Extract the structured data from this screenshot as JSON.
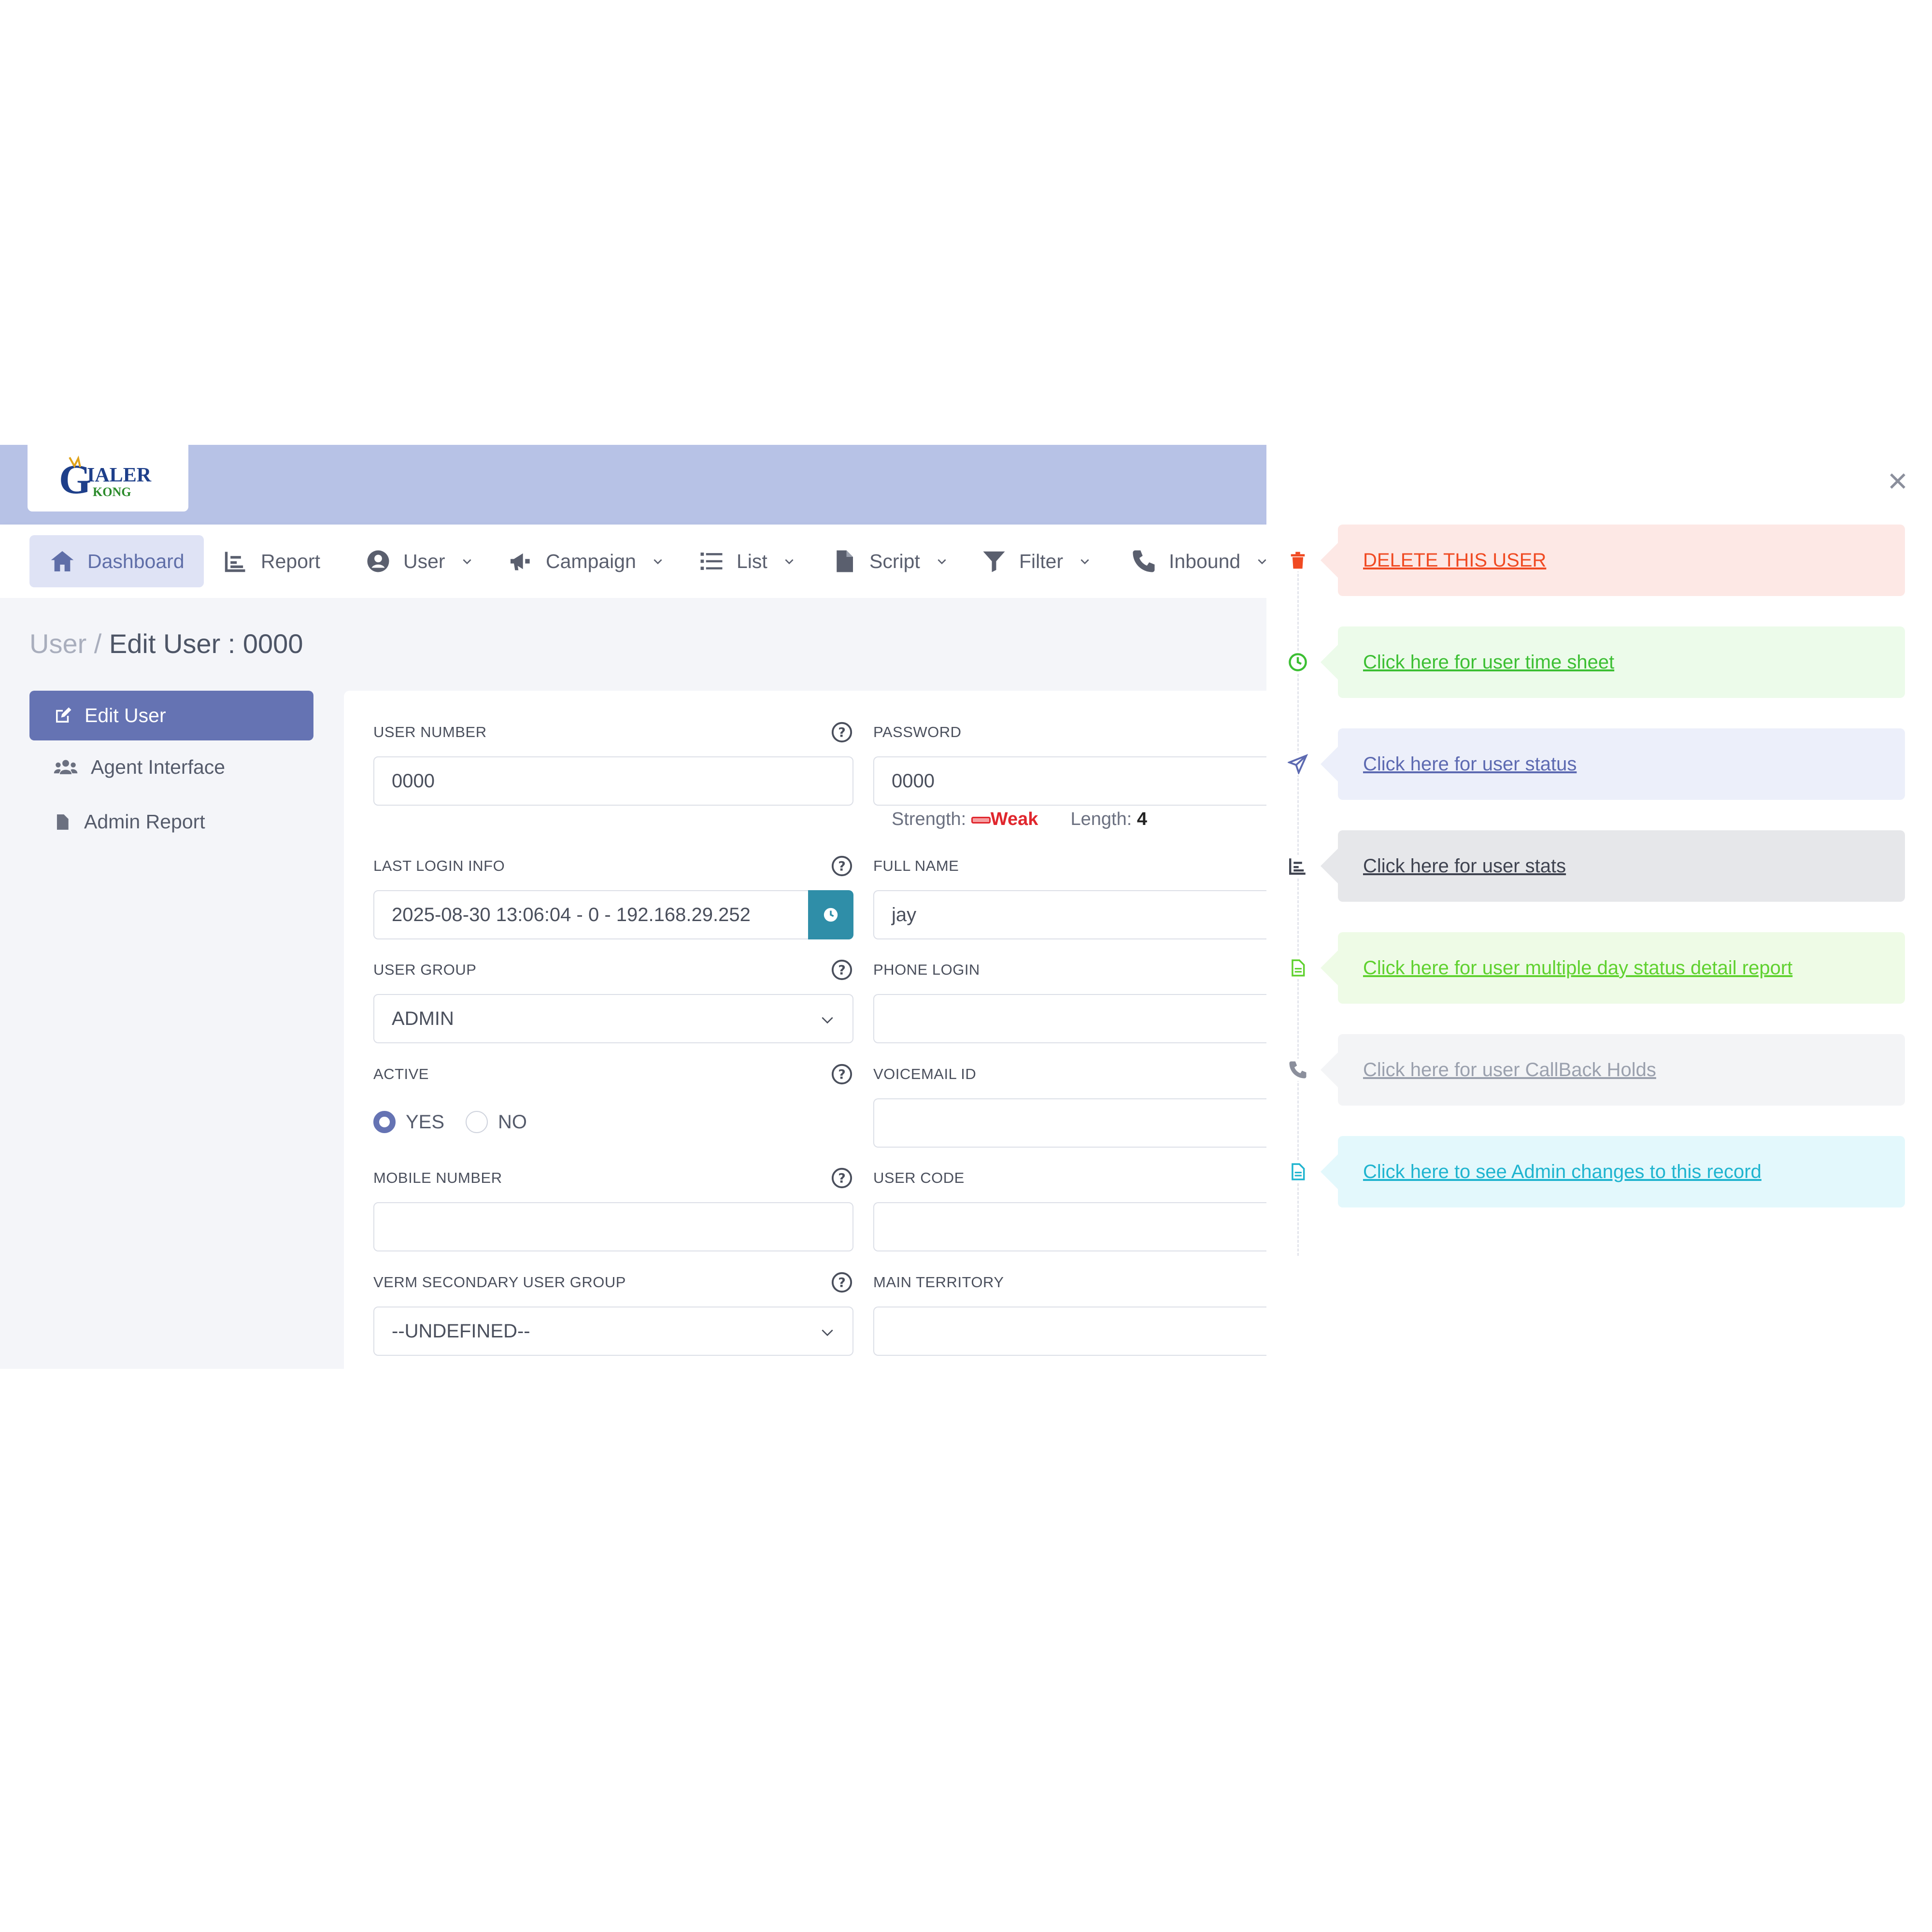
{
  "logo": {
    "text_main": "IALER",
    "text_sub": "KONG"
  },
  "nav": {
    "items": [
      {
        "label": "Dashboard",
        "icon": "home-icon"
      },
      {
        "label": "Report",
        "icon": "chart-icon"
      },
      {
        "label": "User",
        "icon": "user-circle-icon"
      },
      {
        "label": "Campaign",
        "icon": "megaphone-icon"
      },
      {
        "label": "List",
        "icon": "list-icon"
      },
      {
        "label": "Script",
        "icon": "file-icon"
      },
      {
        "label": "Filter",
        "icon": "funnel-icon"
      },
      {
        "label": "Inbound",
        "icon": "phone-icon"
      }
    ]
  },
  "breadcrumb": {
    "parent": "User /",
    "current": "Edit User : 0000"
  },
  "sidebar": {
    "items": [
      {
        "label": "Edit User",
        "icon": "edit-icon"
      },
      {
        "label": "Agent Interface",
        "icon": "users-icon"
      },
      {
        "label": "Admin Report",
        "icon": "file-icon"
      }
    ]
  },
  "form": {
    "user_number": {
      "label": "USER NUMBER",
      "value": "0000"
    },
    "password": {
      "label": "PASSWORD",
      "value": "0000",
      "strength_label": "Strength:",
      "strength_value": "Weak",
      "length_label": "Length:",
      "length_value": "4"
    },
    "last_login": {
      "label": "LAST LOGIN INFO",
      "value": "2025-08-30 13:06:04 - 0 - 192.168.29.252"
    },
    "full_name": {
      "label": "FULL NAME",
      "value": "jay"
    },
    "user_group": {
      "label": "USER GROUP",
      "value": "ADMIN"
    },
    "phone_login": {
      "label": "PHONE LOGIN",
      "value": ""
    },
    "active": {
      "label": "ACTIVE",
      "yes": "YES",
      "no": "NO",
      "selected": "YES"
    },
    "voicemail_id": {
      "label": "VOICEMAIL ID",
      "value": ""
    },
    "mobile_number": {
      "label": "MOBILE NUMBER",
      "value": ""
    },
    "user_code": {
      "label": "USER CODE",
      "value": ""
    },
    "secondary_group": {
      "label": "VERM SECONDARY USER GROUP",
      "value": "--UNDEFINED--"
    },
    "main_territory": {
      "label": "MAIN TERRITORY",
      "value": ""
    }
  },
  "panel": {
    "links": [
      {
        "label": "DELETE THIS USER",
        "icon": "trash-icon",
        "color": "#f04a22",
        "bg": "#fde8e5"
      },
      {
        "label": "Click here for user time sheet",
        "icon": "clock-icon",
        "color": "#3cbf33",
        "bg": "#ecfbea"
      },
      {
        "label": "Click here for user status",
        "icon": "send-icon",
        "color": "#5d6ab1",
        "bg": "#eceffa"
      },
      {
        "label": "Click here for user stats",
        "icon": "chart-icon",
        "color": "#3f4350",
        "bg": "#e6e7ea"
      },
      {
        "label": "Click here for user multiple day status detail report",
        "icon": "document-icon",
        "color": "#5fd12f",
        "bg": "#eefbe6"
      },
      {
        "label": "Click here for user CallBack Holds",
        "icon": "phone-icon",
        "color": "#9aa0ad",
        "bg": "#f3f4f6"
      },
      {
        "label": "Click here to see Admin changes to this record",
        "icon": "document-icon",
        "color": "#1fb4cf",
        "bg": "#e3f8fc"
      }
    ]
  },
  "colors": {
    "topbar": "#b7c2e6",
    "accent": "#6573b3",
    "teal": "#2f8ea8"
  }
}
